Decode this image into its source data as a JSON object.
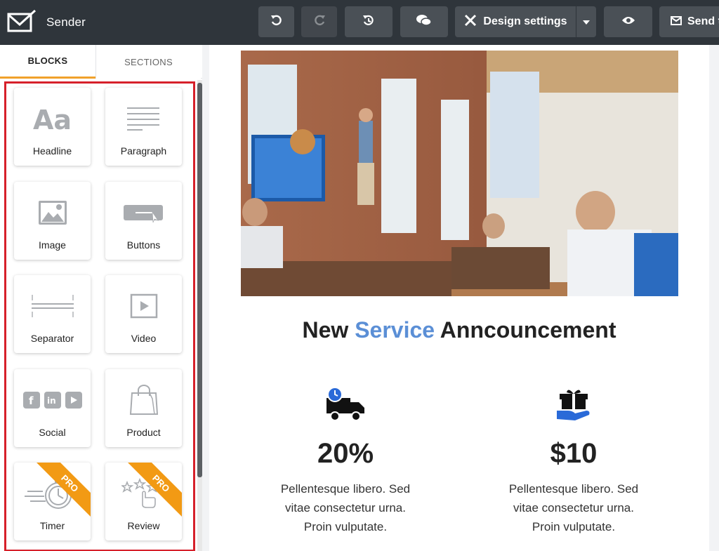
{
  "app": {
    "name": "Sender"
  },
  "toolbar": {
    "undo_icon": "undo-icon",
    "redo_icon": "redo-icon",
    "history_icon": "history-icon",
    "comments_icon": "comments-icon",
    "design_settings_label": "Design settings",
    "preview_icon": "eye-icon",
    "send_label": "Send t"
  },
  "sidebar": {
    "tabs": [
      {
        "label": "BLOCKS"
      },
      {
        "label": "SECTIONS"
      }
    ],
    "blocks": [
      {
        "label": "Headline",
        "icon": "headline-icon"
      },
      {
        "label": "Paragraph",
        "icon": "paragraph-icon"
      },
      {
        "label": "Image",
        "icon": "image-icon"
      },
      {
        "label": "Buttons",
        "icon": "buttons-icon"
      },
      {
        "label": "Separator",
        "icon": "separator-icon"
      },
      {
        "label": "Video",
        "icon": "video-icon"
      },
      {
        "label": "Social",
        "icon": "social-icon"
      },
      {
        "label": "Product",
        "icon": "shopping-bag-icon"
      },
      {
        "label": "Timer",
        "icon": "stopwatch-icon",
        "badge": "PRO"
      },
      {
        "label": "Review",
        "icon": "stars-icon",
        "badge": "PRO"
      }
    ]
  },
  "email": {
    "headline_pre": "New ",
    "headline_accent": "Service",
    "headline_post": " Anncouncement",
    "features": [
      {
        "icon": "delivery-truck-icon",
        "value": "20%",
        "lines": [
          "Pellentesque libero. Sed",
          "vitae consectetur urna.",
          "Proin vulputate."
        ]
      },
      {
        "icon": "gift-hand-icon",
        "value": "$10",
        "lines": [
          "Pellentesque libero. Sed",
          "vitae consectetur urna.",
          "Proin vulputate."
        ]
      }
    ]
  },
  "colors": {
    "topbar": "#2f353b",
    "accent_tab": "#f0a12b",
    "highlight_frame": "#d6202a",
    "pro_ribbon": "#f29a14",
    "headline_accent": "#5b8fd6"
  }
}
